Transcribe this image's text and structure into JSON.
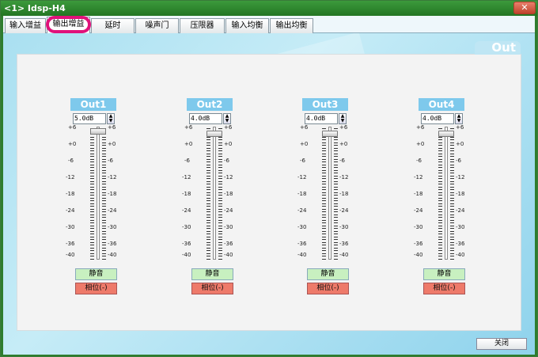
{
  "window": {
    "title": "<1> Idsp-H4",
    "close_glyph": "✕"
  },
  "tabs": [
    {
      "label": "输入增益",
      "active": false
    },
    {
      "label": "输出增益",
      "active": true
    },
    {
      "label": "延时",
      "active": false
    },
    {
      "label": "噪声门",
      "active": false
    },
    {
      "label": "压限器",
      "active": false
    },
    {
      "label": "输入均衡",
      "active": false
    },
    {
      "label": "输出均衡",
      "active": false
    }
  ],
  "panel": {
    "title": "Out"
  },
  "scale_ticks": [
    "+6",
    "+0",
    "-6",
    "-12",
    "-18",
    "-24",
    "-30",
    "-36",
    "-40"
  ],
  "channels": [
    {
      "name": "Out1",
      "value": "5.0dB",
      "gain_db": 5.0,
      "mute_label": "静音",
      "phase_label": "相位(-)"
    },
    {
      "name": "Out2",
      "value": "4.0dB",
      "gain_db": 4.0,
      "mute_label": "静音",
      "phase_label": "相位(-)"
    },
    {
      "name": "Out3",
      "value": "4.0dB",
      "gain_db": 4.0,
      "mute_label": "静音",
      "phase_label": "相位(-)"
    },
    {
      "name": "Out4",
      "value": "4.0dB",
      "gain_db": 4.0,
      "mute_label": "静音",
      "phase_label": "相位(-)"
    }
  ],
  "footer": {
    "close_label": "关闭"
  },
  "colors": {
    "titlebar": "#2e8b2e",
    "channel_label_bg": "#7ec9ec",
    "mute_bg": "#c8f0c0",
    "phase_bg": "#ee7a6a",
    "highlight": "#e0127a"
  }
}
